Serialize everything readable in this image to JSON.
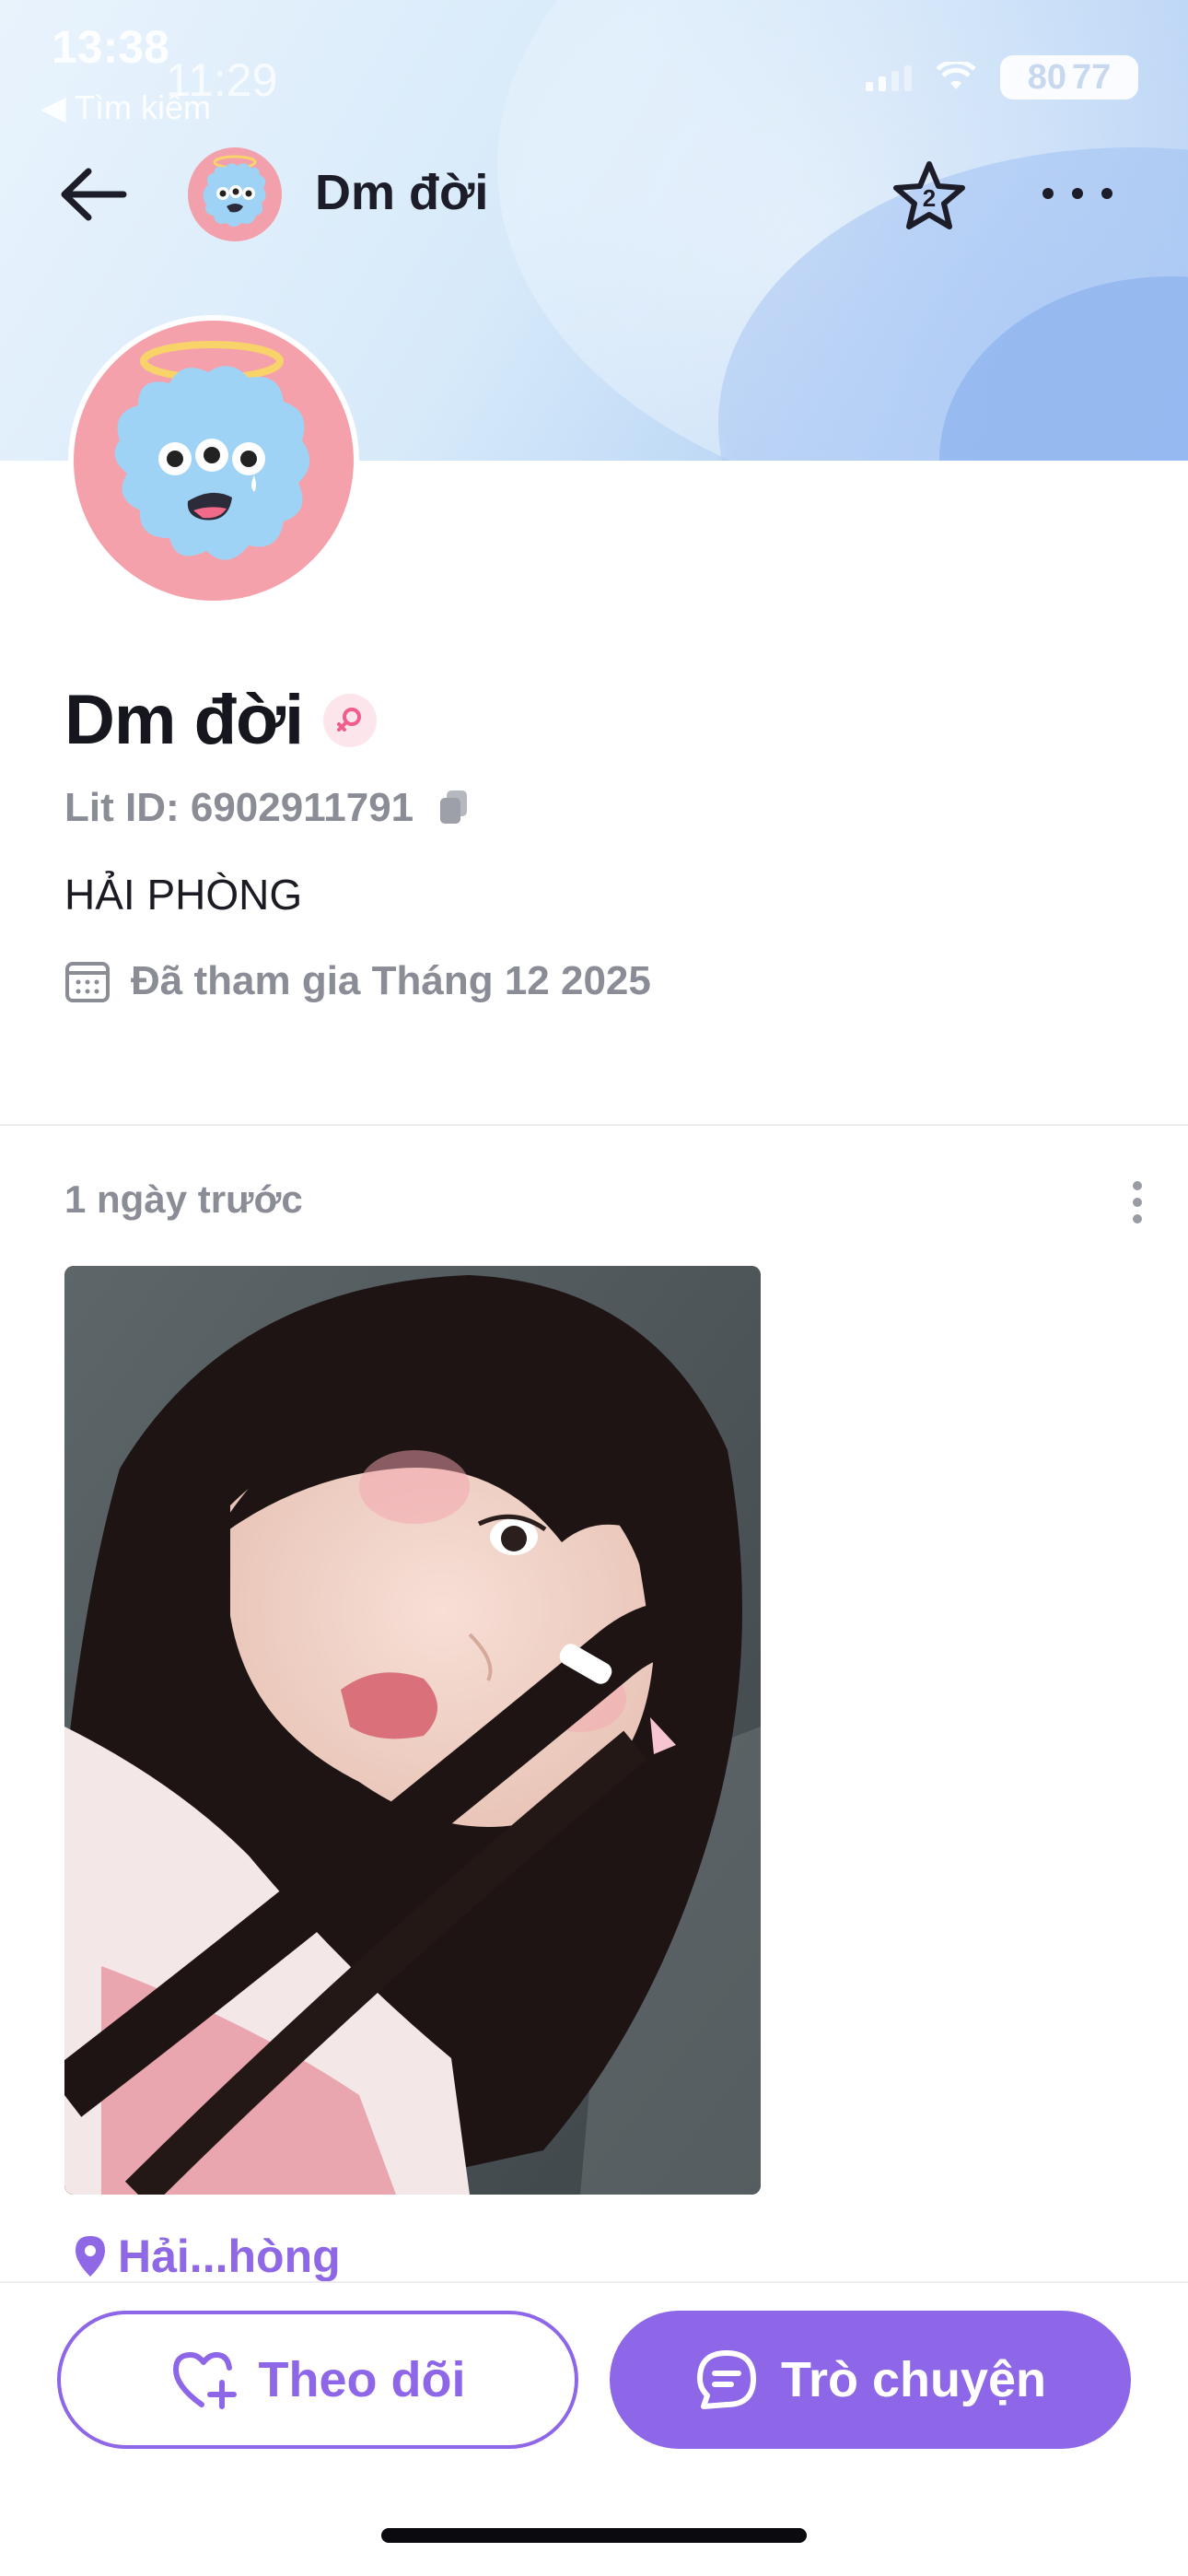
{
  "status_bar": {
    "time_primary": "13:38",
    "time_overlay": "11:29",
    "back_app": "◀ Tìm kiếm",
    "battery": "80",
    "battery_overlay": "77"
  },
  "header": {
    "title": "Dm đời",
    "star_count": "2"
  },
  "profile": {
    "name": "Dm đời",
    "lit_id": "Lit ID: 6902911791",
    "location": "HẢI PHÒNG",
    "joined": "Đã tham gia Tháng 12 2025"
  },
  "post": {
    "time": "1 ngày trước",
    "location": "Hải...hòng"
  },
  "actions": {
    "follow_label": "Theo dõi",
    "chat_label": "Trò chuyện"
  },
  "colors": {
    "accent": "#8e66e8",
    "avatar_bg": "#f5a1ab",
    "monster": "#9fd3f5",
    "muted_text": "#8a8d96"
  },
  "icons": {
    "back": "arrow-left-icon",
    "star": "star-icon",
    "more": "more-horizontal-icon",
    "copy": "copy-icon",
    "calendar": "calendar-icon",
    "gender": "female-icon",
    "location": "map-pin-icon",
    "follow": "heart-plus-icon",
    "chat": "chat-bubble-icon"
  }
}
